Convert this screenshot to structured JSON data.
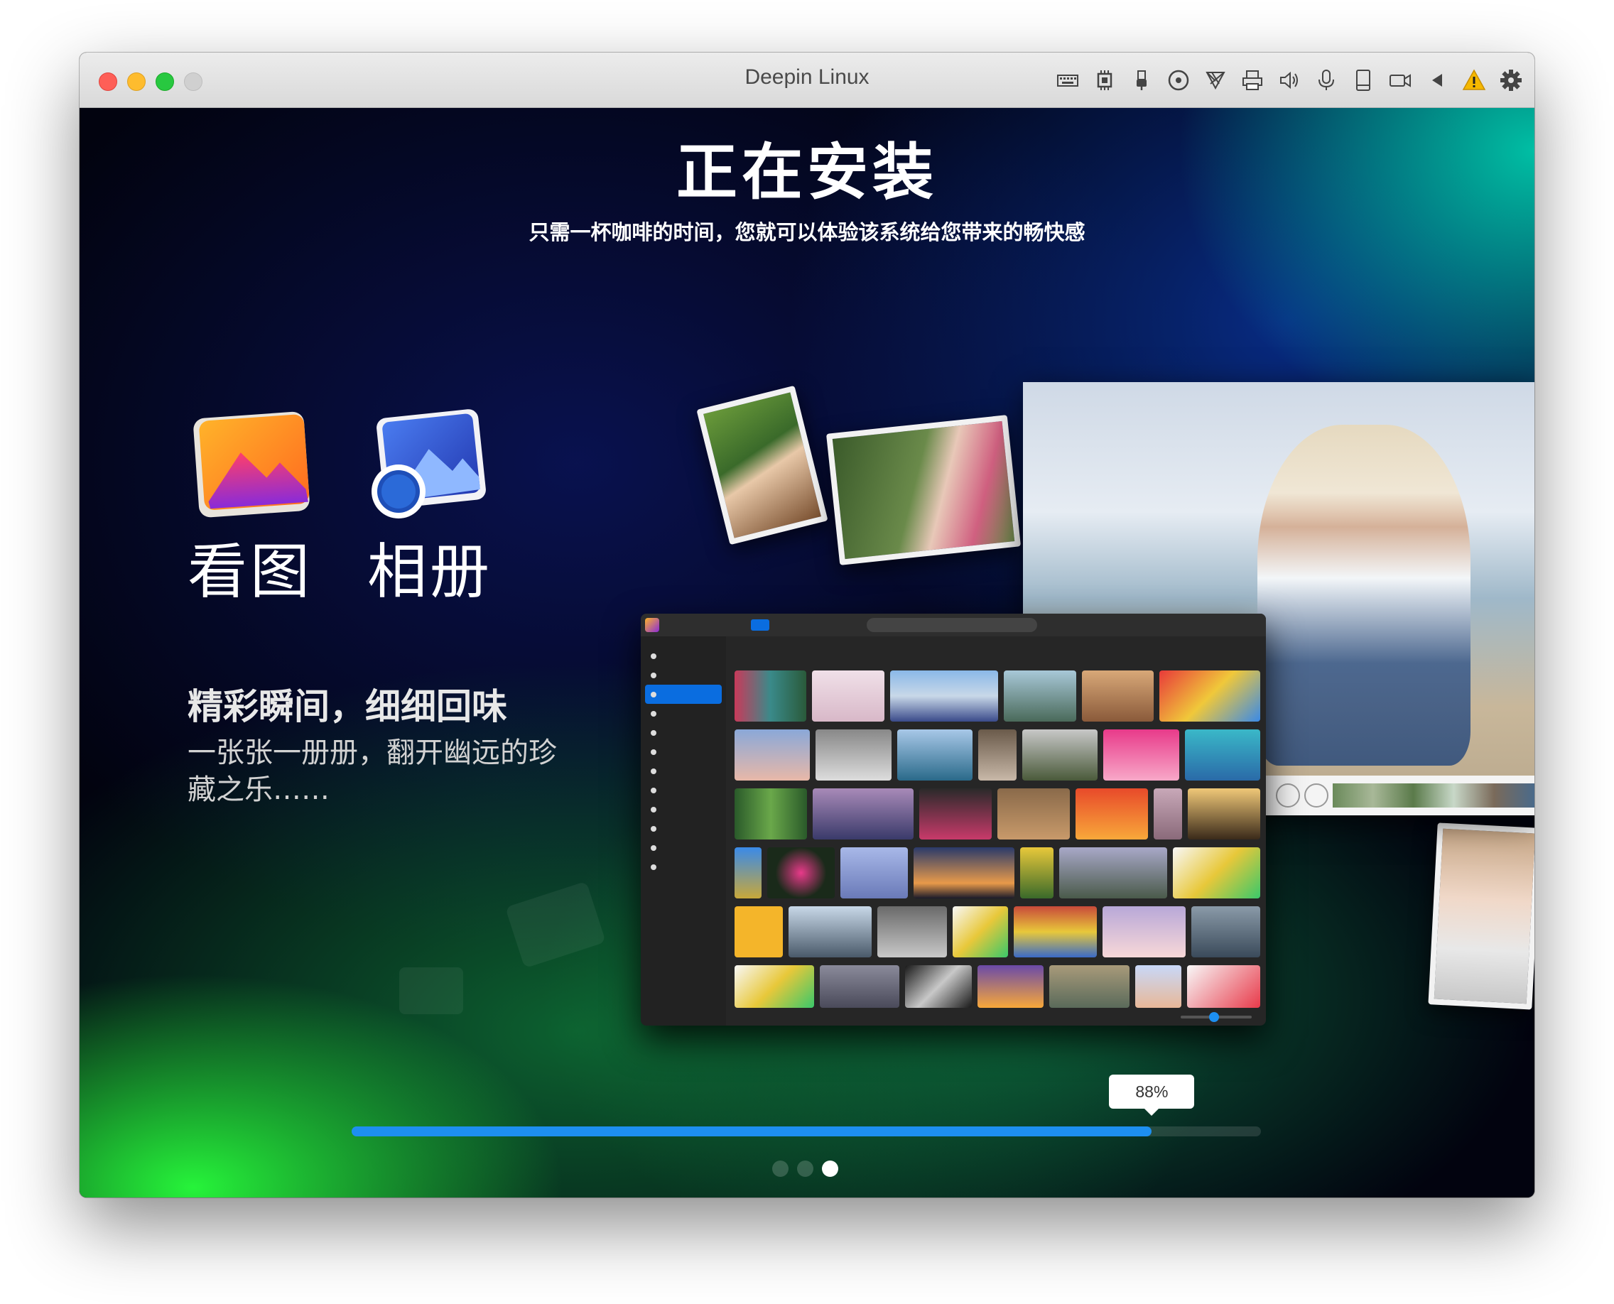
{
  "window": {
    "title": "Deepin Linux",
    "toolbar_icons": [
      "keyboard-icon",
      "cpu-icon",
      "usb-icon",
      "cd-icon",
      "network-icon",
      "printer-icon",
      "speaker-icon",
      "microphone-icon",
      "drive-icon",
      "camera-icon",
      "arrow-left-icon",
      "warning-icon",
      "gear-icon"
    ]
  },
  "installer": {
    "heading": "正在安装",
    "subheading": "只需一杯咖啡的时间，您就可以体验该系统给您带来的畅快感",
    "apps": [
      {
        "name": "看图",
        "icon": "image-viewer-icon"
      },
      {
        "name": "相册",
        "icon": "album-icon"
      }
    ],
    "tagline": "精彩瞬间，细细回味",
    "description": "一张张一册册，翻开幽远的珍藏之乐……",
    "progress": {
      "value": 0.88,
      "label": "88%"
    },
    "pager": {
      "count": 3,
      "active": 2
    }
  },
  "colors": {
    "accent": "#1d8ff0",
    "close": "#fe5f57",
    "minimize": "#febc2e",
    "maximize": "#28c840"
  }
}
